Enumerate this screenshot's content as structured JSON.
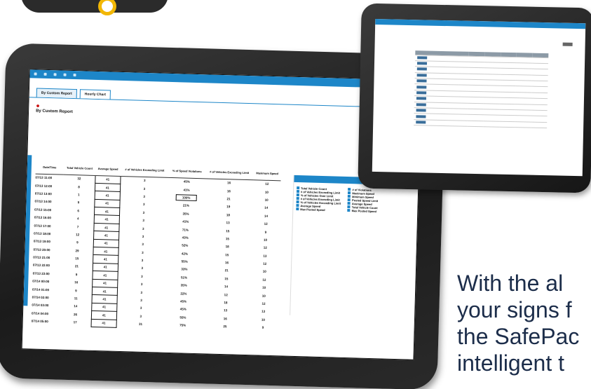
{
  "main_screen": {
    "tabs": [
      "By Custom Report",
      "Hourly Chart"
    ],
    "report_title": "By Custom Report",
    "table_headers": [
      "Date/Time",
      "Total Vehicle Count",
      "Average Speed",
      "# of Vehicles Exceeding Limit",
      "% of Speed Violations",
      "# of Vehicles Exceeding Limit",
      "Maximum Speed"
    ],
    "rows": [
      [
        "07/13 11:00",
        "32",
        "41",
        "3",
        "45%",
        "16",
        "12"
      ],
      [
        "07/13 12:00",
        "8",
        "41",
        "3",
        "41%",
        "16",
        "10"
      ],
      [
        "07/13 13:00",
        "1",
        "41",
        "3",
        "100%",
        "21",
        "10"
      ],
      [
        "07/13 14:00",
        "9",
        "41",
        "3",
        "21%",
        "19",
        "14"
      ],
      [
        "07/13 15:00",
        "6",
        "41",
        "3",
        "35%",
        "18",
        "14"
      ],
      [
        "07/13 16:00",
        "4",
        "41",
        "3",
        "41%",
        "13",
        "12"
      ],
      [
        "07/13 17:00",
        "7",
        "41",
        "3",
        "71%",
        "15",
        "9"
      ],
      [
        "07/13 18:00",
        "12",
        "41",
        "3",
        "43%",
        "15",
        "10"
      ],
      [
        "07/13 19:00",
        "9",
        "41",
        "3",
        "52%",
        "18",
        "12"
      ],
      [
        "07/13 20:00",
        "29",
        "41",
        "3",
        "42%",
        "15",
        "13"
      ],
      [
        "07/13 21:00",
        "15",
        "41",
        "3",
        "55%",
        "16",
        "12"
      ],
      [
        "07/13 22:00",
        "21",
        "41",
        "3",
        "33%",
        "21",
        "10"
      ],
      [
        "07/13 23:00",
        "9",
        "41",
        "3",
        "51%",
        "15",
        "12"
      ],
      [
        "07/14 00:00",
        "16",
        "41",
        "3",
        "35%",
        "14",
        "10"
      ],
      [
        "07/14 01:00",
        "9",
        "41",
        "3",
        "22%",
        "12",
        "10"
      ],
      [
        "07/14 02:00",
        "11",
        "41",
        "3",
        "45%",
        "18",
        "12"
      ],
      [
        "07/14 03:00",
        "14",
        "41",
        "3",
        "45%",
        "13",
        "13"
      ],
      [
        "07/14 04:00",
        "26",
        "41",
        "3",
        "55%",
        "16",
        "10"
      ],
      [
        "07/14 05:00",
        "17",
        "41",
        "31",
        "75%",
        "25",
        "9"
      ]
    ],
    "highlighted_value": "100%",
    "legend_col1": [
      "Total Vehicle Count",
      "# of Vehicles Exceeding Limit",
      "% of Vehicles Over Limit",
      "# of Vehicles Exceeding Limit",
      "% of Vehicles Exceeding Limit",
      "Average Speed",
      "Max Posted Speed"
    ],
    "legend_col2": [
      "# of Violations",
      "Maximum Speed",
      "Minimum Speed",
      "Posted Speed Limit",
      "Average Speed",
      "Total Vehicle Count",
      "Max Posted Speed"
    ]
  },
  "small_screen": {
    "rows": 12
  },
  "caption": {
    "line1": "With the al",
    "line2": "your signs f",
    "line3": "the SafePac",
    "line4": "intelligent t"
  },
  "colors": {
    "accent": "#1d86c8",
    "caption": "#1c2d4a",
    "ring": "#f2b705",
    "highlight_icon": "#cc1111"
  }
}
